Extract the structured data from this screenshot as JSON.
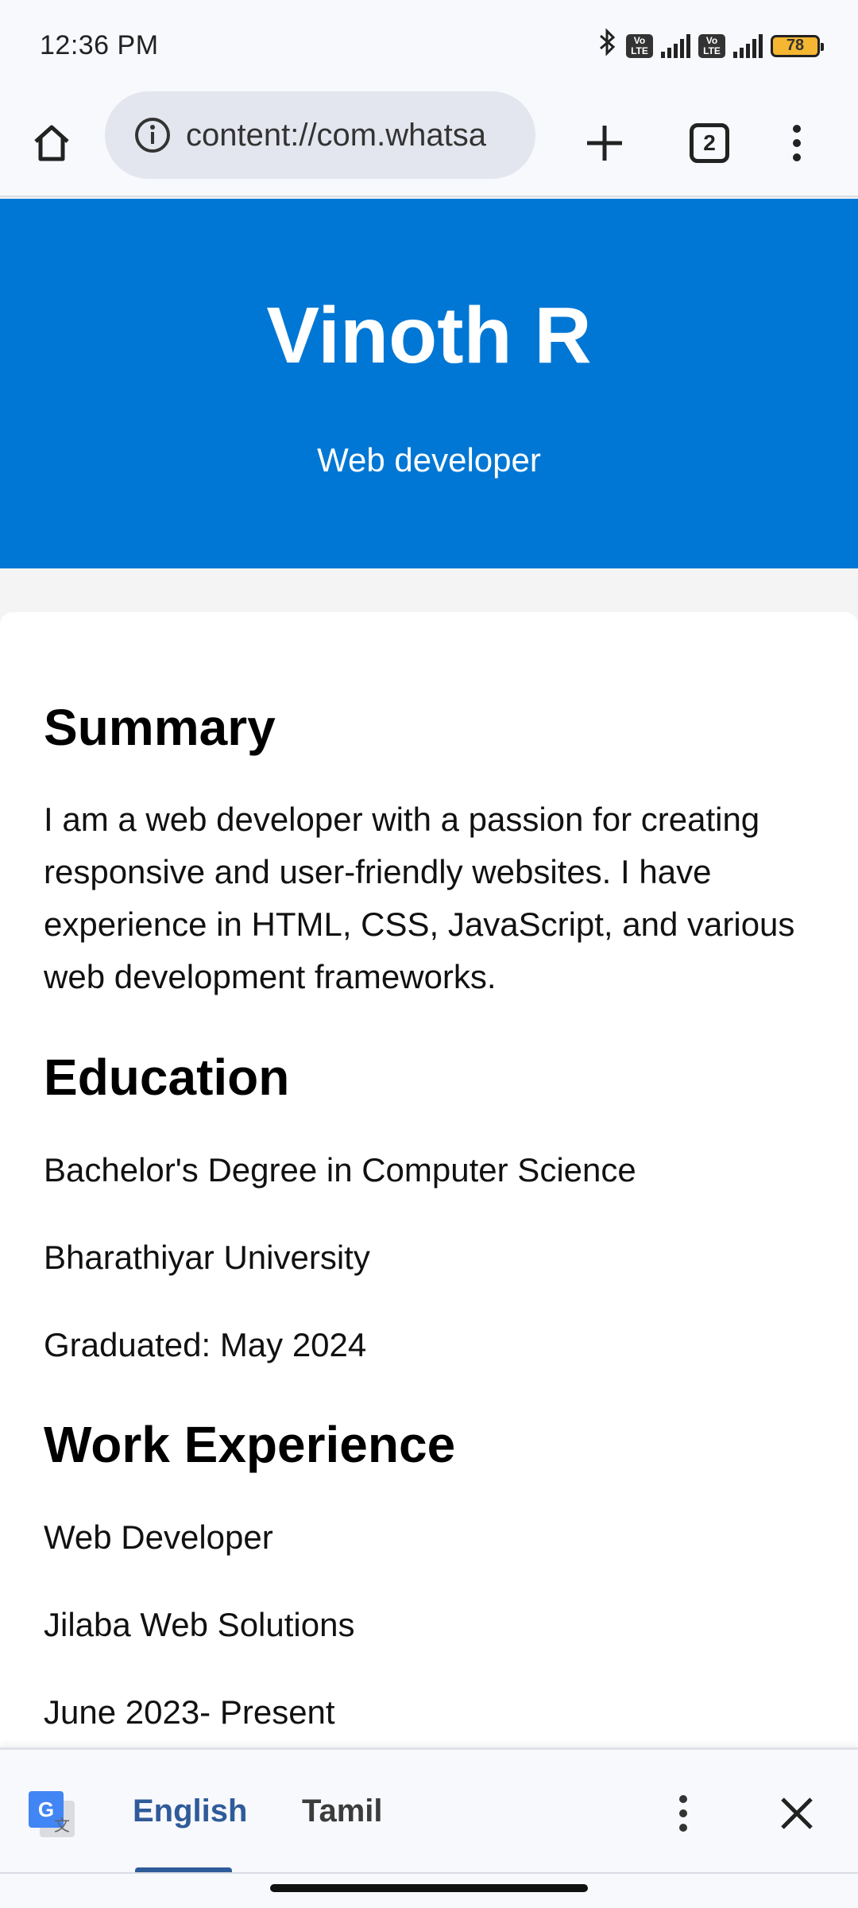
{
  "status_bar": {
    "time": "12:36 PM",
    "battery": "78",
    "lte_label": "Vo LTE",
    "icons": [
      "bluetooth-icon",
      "volte-icon",
      "signal-icon",
      "volte-icon",
      "signal-icon",
      "battery-icon"
    ]
  },
  "browser": {
    "url": "content://com.whatsa",
    "tab_count": "2",
    "icons": [
      "home-icon",
      "info-icon",
      "plus-icon",
      "tabs-icon",
      "more-vert-icon"
    ]
  },
  "page": {
    "name": "Vinoth R",
    "role": "Web developer",
    "summary_title": "Summary",
    "summary_text": "I am a web developer with a passion for creating responsive and user-friendly websites. I have experience in HTML, CSS, JavaScript, and various web development frameworks.",
    "education_title": "Education",
    "education": [
      "Bachelor's Degree in Computer Science",
      "Bharathiyar University",
      "Graduated: May 2024"
    ],
    "work_title": "Work Experience",
    "work": [
      "Web Developer",
      "Jilaba Web Solutions",
      "June 2023- Present"
    ]
  },
  "translate_bar": {
    "languages": [
      "English",
      "Tamil"
    ],
    "selected": "English",
    "icons": [
      "google-translate-icon",
      "more-vert-icon",
      "close-icon"
    ]
  },
  "colors": {
    "hero_bg": "#0077d4",
    "browser_bg": "#f8f9fc",
    "accent": "#2f5b9a"
  }
}
